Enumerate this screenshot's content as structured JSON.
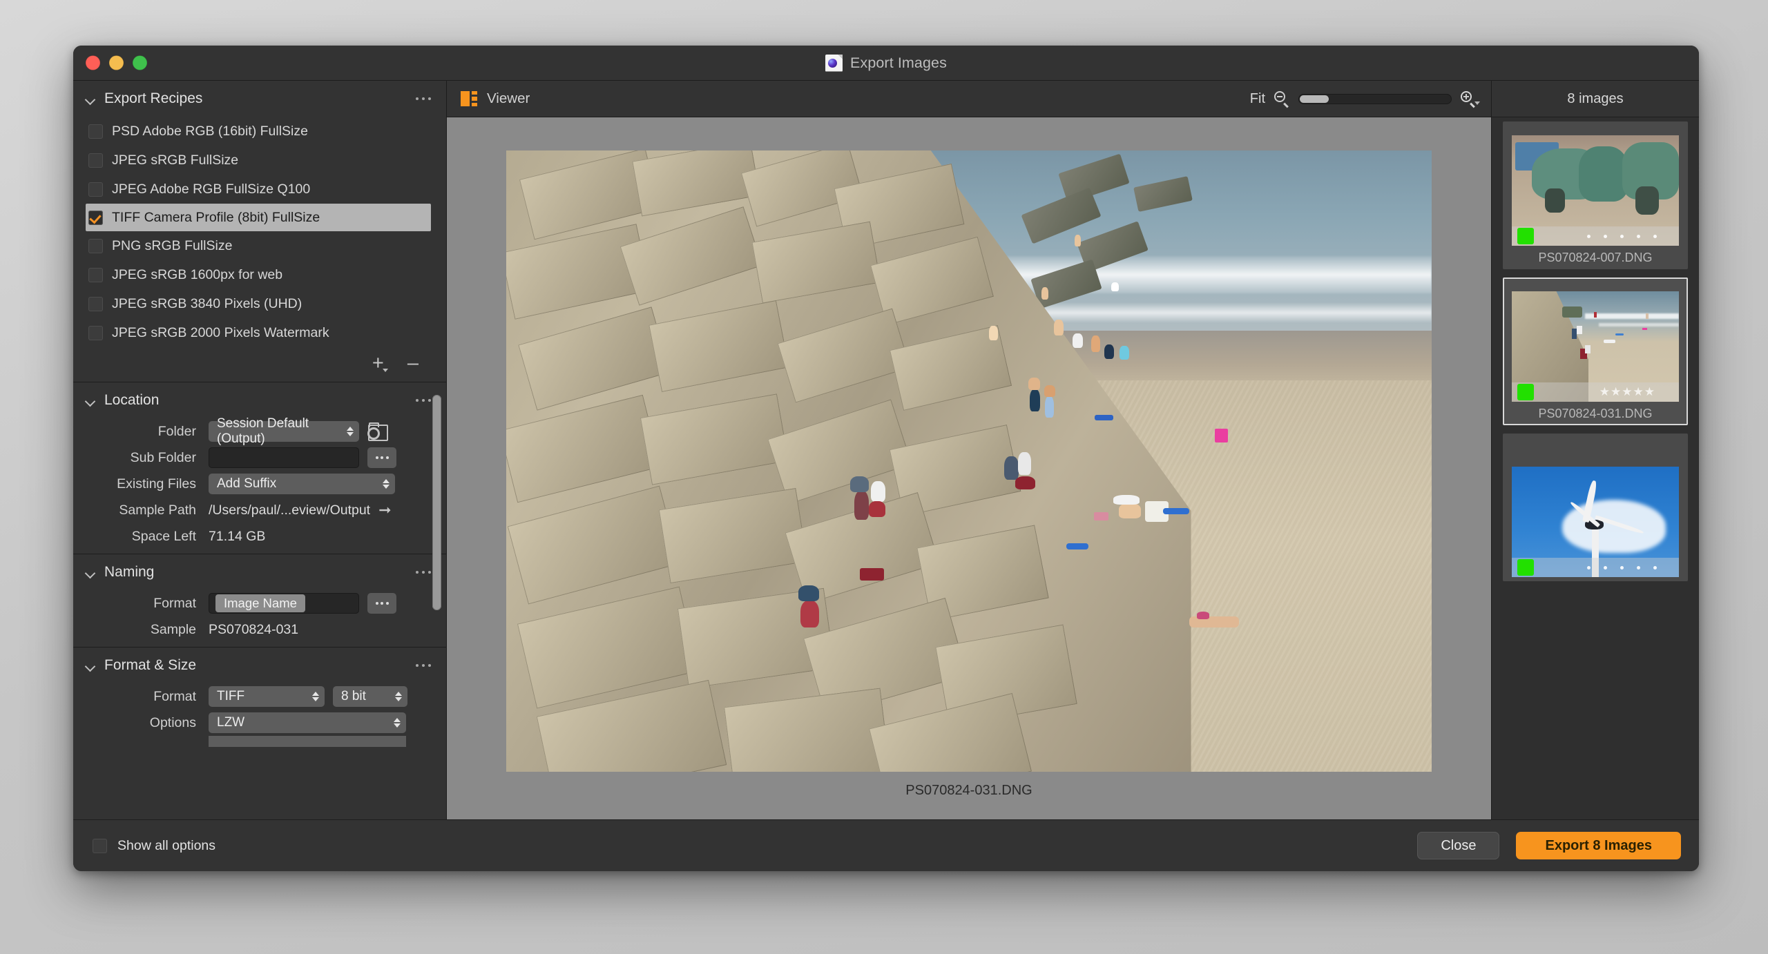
{
  "window": {
    "title": "Export Images",
    "title_icon": "document-orb-icon",
    "traffic_lights": [
      "close-red",
      "minimize-yellow",
      "maximize-green"
    ]
  },
  "sidebar": {
    "recipes_panel": {
      "title": "Export Recipes",
      "menu_icon": "ellipsis-icon",
      "items": [
        {
          "label": "PSD Adobe RGB (16bit) FullSize",
          "checked": false,
          "selected": false
        },
        {
          "label": "JPEG sRGB FullSize",
          "checked": false,
          "selected": false
        },
        {
          "label": "JPEG  Adobe RGB FullSize Q100",
          "checked": false,
          "selected": false
        },
        {
          "label": "TIFF Camera Profile (8bit) FullSize",
          "checked": true,
          "selected": true
        },
        {
          "label": "PNG sRGB FullSize",
          "checked": false,
          "selected": false
        },
        {
          "label": "JPEG sRGB 1600px for web",
          "checked": false,
          "selected": false
        },
        {
          "label": "JPEG sRGB 3840 Pixels (UHD)",
          "checked": false,
          "selected": false
        },
        {
          "label": "JPEG sRGB 2000 Pixels Watermark",
          "checked": false,
          "selected": false
        }
      ],
      "add_label": "+",
      "remove_label": "–"
    },
    "location_panel": {
      "title": "Location",
      "menu_icon": "ellipsis-icon",
      "folder_label": "Folder",
      "folder_value": "Session Default (Output)",
      "folder_picker_icon": "folder-settings-icon",
      "sub_folder_label": "Sub Folder",
      "sub_folder_value": "",
      "sub_folder_placeholder": "",
      "sub_folder_more": "...",
      "existing_files_label": "Existing Files",
      "existing_files_value": "Add Suffix",
      "sample_path_label": "Sample Path",
      "sample_path_value": "/Users/paul/...eview/Output",
      "sample_path_icon": "arrow-right-icon",
      "space_left_label": "Space Left",
      "space_left_value": "71.14 GB"
    },
    "naming_panel": {
      "title": "Naming",
      "menu_icon": "ellipsis-icon",
      "format_label": "Format",
      "format_token": "Image Name",
      "format_more": "...",
      "sample_label": "Sample",
      "sample_value": "PS070824-031"
    },
    "format_size_panel": {
      "title": "Format & Size",
      "menu_icon": "ellipsis-icon",
      "format_label": "Format",
      "format_value": "TIFF",
      "bit_depth_value": "8 bit",
      "options_label": "Options",
      "options_value": "LZW"
    }
  },
  "viewer": {
    "icon": "viewer-grid-icon",
    "title": "Viewer",
    "zoom_label": "Fit",
    "zoom_out_icon": "magnifier-minus-icon",
    "zoom_in_icon": "magnifier-plus-icon",
    "zoom_slider_percent": 0,
    "image_caption": "PS070824-031.DNG"
  },
  "thumbnails": {
    "header": "8 images",
    "items": [
      {
        "name": "PS070824-007.DNG",
        "selected": false,
        "badge_color": "#22e000",
        "overlay": "dots"
      },
      {
        "name": "PS070824-031.DNG",
        "selected": true,
        "badge_color": "#22e000",
        "overlay": "stars"
      },
      {
        "name": "",
        "selected": false,
        "badge_color": "#22e000",
        "overlay": "dots"
      }
    ],
    "star_glyph": "★★★★★"
  },
  "footer": {
    "show_all_options_label": "Show all options",
    "show_all_options_checked": false,
    "close_label": "Close",
    "export_label": "Export 8 Images",
    "export_accent": "#f7941e"
  }
}
